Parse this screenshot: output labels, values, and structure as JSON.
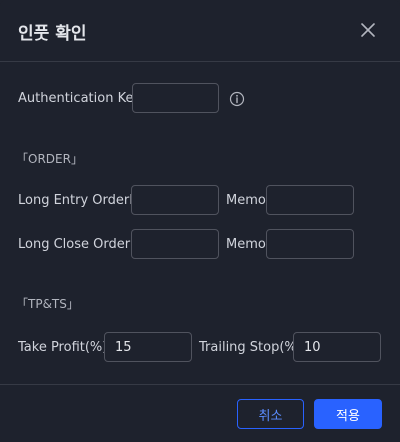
{
  "dialog": {
    "title": "인풋 확인"
  },
  "auth": {
    "label": "Authentication Key",
    "value": ""
  },
  "order": {
    "section_label": "「ORDER」",
    "long_entry_label": "Long Entry OrderID",
    "long_entry_value": "",
    "long_close_label": "Long Close OrderID",
    "long_close_value": "",
    "memo_label": "Memo",
    "memo_entry_value": "",
    "memo_close_value": ""
  },
  "tpts": {
    "section_label": "「TP&TS」",
    "take_profit_label": "Take Profit(%)",
    "take_profit_value": "15",
    "trailing_stop_label": "Trailing Stop(%)",
    "trailing_stop_value": "10"
  },
  "footer": {
    "cancel_label": "취소",
    "apply_label": "적용"
  },
  "icons": {
    "close": "close-icon",
    "info": "info-icon"
  },
  "colors": {
    "background": "#1e222d",
    "accent": "#2962ff",
    "border": "#50535e"
  }
}
